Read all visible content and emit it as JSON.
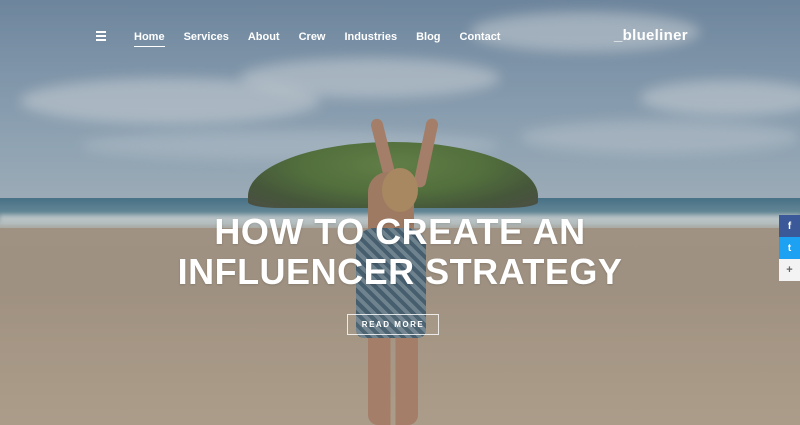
{
  "nav": {
    "menu_icon": "hamburger-icon",
    "items": [
      {
        "label": "Home",
        "active": true
      },
      {
        "label": "Services"
      },
      {
        "label": "About"
      },
      {
        "label": "Crew"
      },
      {
        "label": "Industries"
      },
      {
        "label": "Blog"
      },
      {
        "label": "Contact"
      }
    ]
  },
  "logo": "_blueliner",
  "hero": {
    "title_line1": "HOW TO CREATE AN",
    "title_line2": "INFLUENCER STRATEGY",
    "button_label": "READ MORE"
  },
  "share": {
    "facebook": {
      "icon": "facebook-icon",
      "glyph": "f",
      "color": "#3b5998"
    },
    "twitter": {
      "icon": "twitter-icon",
      "glyph": "t",
      "color": "#1da1f2"
    },
    "more": {
      "icon": "plus-icon",
      "glyph": "+"
    }
  }
}
